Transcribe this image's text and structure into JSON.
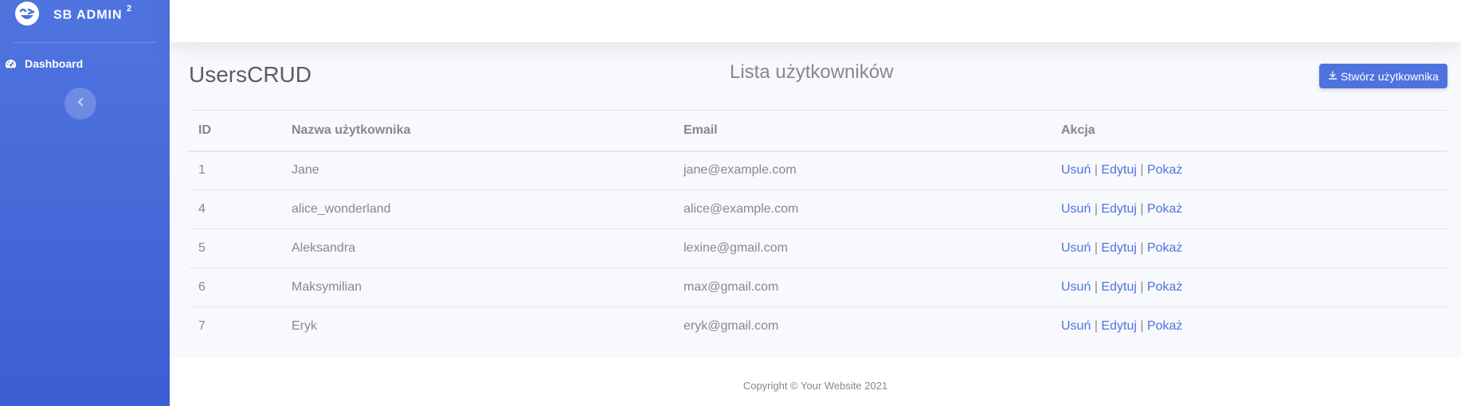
{
  "sidebar": {
    "brand_text": "SB ADMIN",
    "brand_sup": "2",
    "nav_item_label": "Dashboard",
    "nav_item_icon": "tachometer-icon",
    "toggle_icon": "chevron-left-icon"
  },
  "main": {
    "page_title": "UsersCRUD",
    "list_title": "Lista użytkowników",
    "create_button": {
      "label": "Stwórz użytkownika",
      "icon": "download-icon"
    },
    "table": {
      "columns": [
        "ID",
        "Nazwa użytkownika",
        "Email",
        "Akcja"
      ],
      "rows": [
        {
          "id": "1",
          "name": "Jane",
          "email": "jane@example.com"
        },
        {
          "id": "4",
          "name": "alice_wonderland",
          "email": "alice@example.com"
        },
        {
          "id": "5",
          "name": "Aleksandra",
          "email": "lexine@gmail.com"
        },
        {
          "id": "6",
          "name": "Maksymilian",
          "email": "max@gmail.com"
        },
        {
          "id": "7",
          "name": "Eryk",
          "email": "eryk@gmail.com"
        }
      ],
      "actions": {
        "delete": "Usuń",
        "edit": "Edytuj",
        "show": "Pokaż",
        "separator": "|"
      }
    }
  },
  "footer": {
    "copyright": "Copyright © Your Website 2021"
  },
  "colors": {
    "primary": "#4e73df",
    "sidebar_gradient_end": "#3b5ed0",
    "text_muted": "#858796",
    "heading": "#5a5c69",
    "page_bg": "#f8f9fc"
  }
}
